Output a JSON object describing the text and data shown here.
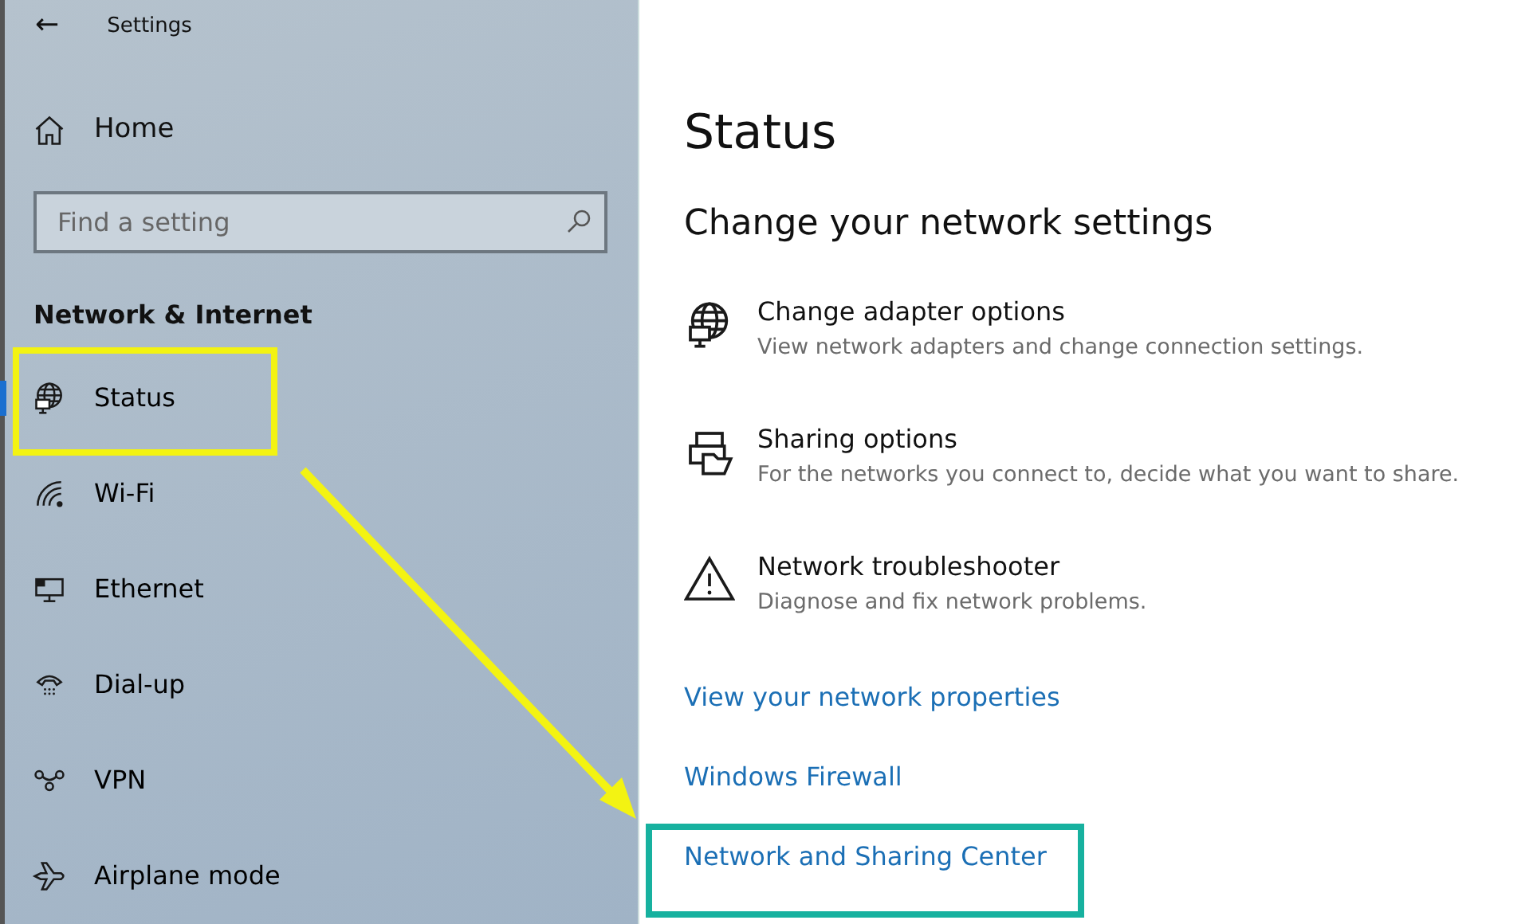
{
  "window": {
    "title": "Settings",
    "back": "←"
  },
  "sidebar": {
    "home": "Home",
    "search": {
      "placeholder": "Find a setting"
    },
    "heading": "Network & Internet",
    "items": [
      {
        "label": "Status",
        "selected": true,
        "highlighted": true
      },
      {
        "label": "Wi-Fi",
        "selected": false,
        "highlighted": false
      },
      {
        "label": "Ethernet",
        "selected": false,
        "highlighted": false
      },
      {
        "label": "Dial-up",
        "selected": false,
        "highlighted": false
      },
      {
        "label": "VPN",
        "selected": false,
        "highlighted": false
      },
      {
        "label": "Airplane mode",
        "selected": false,
        "highlighted": false
      }
    ]
  },
  "main": {
    "title": "Status",
    "heading": "Change your network settings",
    "options": [
      {
        "title": "Change adapter options",
        "description": "View network adapters and change connection settings."
      },
      {
        "title": "Sharing options",
        "description": "For the networks you connect to, decide what you want to share."
      },
      {
        "title": "Network troubleshooter",
        "description": "Diagnose and fix network problems."
      }
    ],
    "links": [
      {
        "label": "View your network properties",
        "highlighted": false
      },
      {
        "label": "Windows Firewall",
        "highlighted": false
      },
      {
        "label": "Network and Sharing Center",
        "highlighted": true
      }
    ]
  },
  "annotation_arrow": true
}
